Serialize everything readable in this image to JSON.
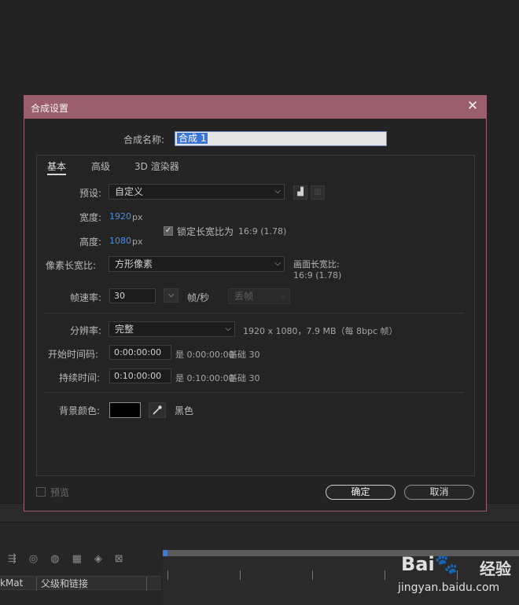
{
  "dialog": {
    "title": "合成设置",
    "close_glyph": "✕",
    "name_label": "合成名称:",
    "name_value": "合成 1"
  },
  "tabs": [
    {
      "label": "基本"
    },
    {
      "label": "高级"
    },
    {
      "label": "3D 渲染器"
    }
  ],
  "basic": {
    "preset_label": "预设:",
    "preset_value": "自定义",
    "width_label": "宽度:",
    "width_value": "1920",
    "width_unit": "px",
    "height_label": "高度:",
    "height_value": "1080",
    "height_unit": "px",
    "lock_label": "锁定长宽比为",
    "lock_ratio": "16:9 (1.78)",
    "pixel_aspect_label": "像素长宽比:",
    "pixel_aspect_value": "方形像素",
    "frame_aspect_label": "画面长宽比:",
    "frame_aspect_value": "16:9 (1.78)",
    "frame_rate_label": "帧速率:",
    "frame_rate_value": "30",
    "frame_rate_unit": "帧/秒",
    "drop_frame_value": "丢帧",
    "resolution_label": "分辨率:",
    "resolution_value": "完整",
    "resolution_info": "1920 x 1080，7.9 MB（每 8bpc 帧）",
    "start_tc_label": "开始时间码:",
    "start_tc_value": "0:00:00:00",
    "start_tc_is": "是 0:00:00:00",
    "start_tc_base": "基础 30",
    "duration_label": "持续时间:",
    "duration_value": "0:10:00:00",
    "duration_is": "是 0:10:00:00",
    "duration_base": "基础 30",
    "bg_color_label": "背景颜色:",
    "bg_color_name": "黑色",
    "bg_color_hex": "#000000"
  },
  "footer": {
    "preview_label": "预览",
    "ok_label": "确定",
    "cancel_label": "取消"
  },
  "background": {
    "col1_header": "kMat",
    "col2_header": "父级和链接"
  },
  "watermark": {
    "logo_text": "Bai",
    "logo_text2": "百",
    "jingyan": "经验",
    "url": "jingyan.baidu.com"
  },
  "colors": {
    "titlebar": "#9b5e6b",
    "accent_blue": "#4a8fe0"
  }
}
